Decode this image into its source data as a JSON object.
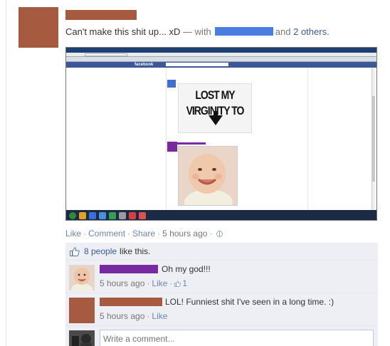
{
  "post": {
    "status_text": "Can't make this shit up... xD",
    "with_sep": " — with",
    "and_text": "and",
    "others_text": "2 others."
  },
  "screenshot": {
    "site_logo": "facebook",
    "meme_line1": "LOST MY",
    "meme_line2": "VIRGINITY TO"
  },
  "actions": {
    "like": "Like",
    "comment": "Comment",
    "share": "Share",
    "time": "5 hours ago"
  },
  "likes": {
    "count_text": "8 people",
    "suffix": "like this."
  },
  "comments": [
    {
      "text": "Oh my god!!!",
      "time": "5 hours ago",
      "like": "Like",
      "like_count": "1"
    },
    {
      "text": "LOL! Funniest shit I've seen in a long time. :)",
      "time": "5 hours ago",
      "like": "Like"
    }
  ],
  "write_comment": {
    "placeholder": "Write a comment..."
  },
  "colors": {
    "link": "#3b5998",
    "redact_brown": "#a65a3f",
    "redact_blue": "#4a7de0",
    "redact_purple": "#7a2aa0"
  }
}
